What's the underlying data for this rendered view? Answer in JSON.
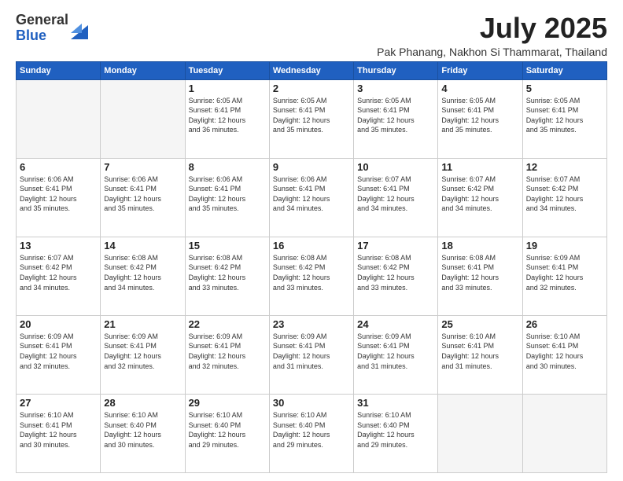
{
  "logo": {
    "general": "General",
    "blue": "Blue"
  },
  "title": {
    "month_year": "July 2025",
    "location": "Pak Phanang, Nakhon Si Thammarat, Thailand"
  },
  "days_of_week": [
    "Sunday",
    "Monday",
    "Tuesday",
    "Wednesday",
    "Thursday",
    "Friday",
    "Saturday"
  ],
  "weeks": [
    [
      {
        "day": "",
        "empty": true
      },
      {
        "day": "",
        "empty": true
      },
      {
        "day": "1",
        "sunrise": "6:05 AM",
        "sunset": "6:41 PM",
        "daylight": "12 hours and 36 minutes."
      },
      {
        "day": "2",
        "sunrise": "6:05 AM",
        "sunset": "6:41 PM",
        "daylight": "12 hours and 35 minutes."
      },
      {
        "day": "3",
        "sunrise": "6:05 AM",
        "sunset": "6:41 PM",
        "daylight": "12 hours and 35 minutes."
      },
      {
        "day": "4",
        "sunrise": "6:05 AM",
        "sunset": "6:41 PM",
        "daylight": "12 hours and 35 minutes."
      },
      {
        "day": "5",
        "sunrise": "6:05 AM",
        "sunset": "6:41 PM",
        "daylight": "12 hours and 35 minutes."
      }
    ],
    [
      {
        "day": "6",
        "sunrise": "6:06 AM",
        "sunset": "6:41 PM",
        "daylight": "12 hours and 35 minutes."
      },
      {
        "day": "7",
        "sunrise": "6:06 AM",
        "sunset": "6:41 PM",
        "daylight": "12 hours and 35 minutes."
      },
      {
        "day": "8",
        "sunrise": "6:06 AM",
        "sunset": "6:41 PM",
        "daylight": "12 hours and 35 minutes."
      },
      {
        "day": "9",
        "sunrise": "6:06 AM",
        "sunset": "6:41 PM",
        "daylight": "12 hours and 34 minutes."
      },
      {
        "day": "10",
        "sunrise": "6:07 AM",
        "sunset": "6:41 PM",
        "daylight": "12 hours and 34 minutes."
      },
      {
        "day": "11",
        "sunrise": "6:07 AM",
        "sunset": "6:42 PM",
        "daylight": "12 hours and 34 minutes."
      },
      {
        "day": "12",
        "sunrise": "6:07 AM",
        "sunset": "6:42 PM",
        "daylight": "12 hours and 34 minutes."
      }
    ],
    [
      {
        "day": "13",
        "sunrise": "6:07 AM",
        "sunset": "6:42 PM",
        "daylight": "12 hours and 34 minutes."
      },
      {
        "day": "14",
        "sunrise": "6:08 AM",
        "sunset": "6:42 PM",
        "daylight": "12 hours and 34 minutes."
      },
      {
        "day": "15",
        "sunrise": "6:08 AM",
        "sunset": "6:42 PM",
        "daylight": "12 hours and 33 minutes."
      },
      {
        "day": "16",
        "sunrise": "6:08 AM",
        "sunset": "6:42 PM",
        "daylight": "12 hours and 33 minutes."
      },
      {
        "day": "17",
        "sunrise": "6:08 AM",
        "sunset": "6:42 PM",
        "daylight": "12 hours and 33 minutes."
      },
      {
        "day": "18",
        "sunrise": "6:08 AM",
        "sunset": "6:41 PM",
        "daylight": "12 hours and 33 minutes."
      },
      {
        "day": "19",
        "sunrise": "6:09 AM",
        "sunset": "6:41 PM",
        "daylight": "12 hours and 32 minutes."
      }
    ],
    [
      {
        "day": "20",
        "sunrise": "6:09 AM",
        "sunset": "6:41 PM",
        "daylight": "12 hours and 32 minutes."
      },
      {
        "day": "21",
        "sunrise": "6:09 AM",
        "sunset": "6:41 PM",
        "daylight": "12 hours and 32 minutes."
      },
      {
        "day": "22",
        "sunrise": "6:09 AM",
        "sunset": "6:41 PM",
        "daylight": "12 hours and 32 minutes."
      },
      {
        "day": "23",
        "sunrise": "6:09 AM",
        "sunset": "6:41 PM",
        "daylight": "12 hours and 31 minutes."
      },
      {
        "day": "24",
        "sunrise": "6:09 AM",
        "sunset": "6:41 PM",
        "daylight": "12 hours and 31 minutes."
      },
      {
        "day": "25",
        "sunrise": "6:10 AM",
        "sunset": "6:41 PM",
        "daylight": "12 hours and 31 minutes."
      },
      {
        "day": "26",
        "sunrise": "6:10 AM",
        "sunset": "6:41 PM",
        "daylight": "12 hours and 30 minutes."
      }
    ],
    [
      {
        "day": "27",
        "sunrise": "6:10 AM",
        "sunset": "6:41 PM",
        "daylight": "12 hours and 30 minutes."
      },
      {
        "day": "28",
        "sunrise": "6:10 AM",
        "sunset": "6:40 PM",
        "daylight": "12 hours and 30 minutes."
      },
      {
        "day": "29",
        "sunrise": "6:10 AM",
        "sunset": "6:40 PM",
        "daylight": "12 hours and 29 minutes."
      },
      {
        "day": "30",
        "sunrise": "6:10 AM",
        "sunset": "6:40 PM",
        "daylight": "12 hours and 29 minutes."
      },
      {
        "day": "31",
        "sunrise": "6:10 AM",
        "sunset": "6:40 PM",
        "daylight": "12 hours and 29 minutes."
      },
      {
        "day": "",
        "empty": true
      },
      {
        "day": "",
        "empty": true
      }
    ]
  ]
}
